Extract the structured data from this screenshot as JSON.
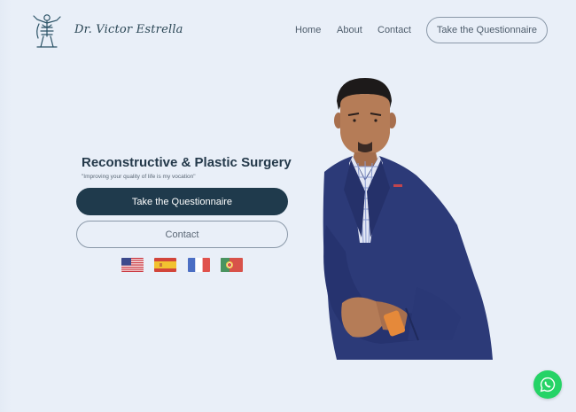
{
  "header": {
    "brand_name": "Dr. Victor Estrella",
    "nav": {
      "home": "Home",
      "about": "About",
      "contact": "Contact"
    },
    "cta_label": "Take the Questionnaire"
  },
  "hero": {
    "title": "Reconstructive & Plastic Surgery",
    "tagline": "\"Improving your quality of life is my vocation\"",
    "primary_button": "Take the Questionnaire",
    "secondary_button": "Contact"
  },
  "languages": [
    {
      "icon": "us-flag-icon"
    },
    {
      "icon": "spain-flag-icon"
    },
    {
      "icon": "france-flag-icon"
    },
    {
      "icon": "portugal-flag-icon"
    }
  ],
  "colors": {
    "background": "#e9eff8",
    "primary_button": "#1f3a4c",
    "heading": "#24394a",
    "whatsapp": "#25d366",
    "suit": "#2c3a78"
  },
  "icons": {
    "logo": "surgeon-statue-logo-icon",
    "chat": "whatsapp-icon"
  }
}
